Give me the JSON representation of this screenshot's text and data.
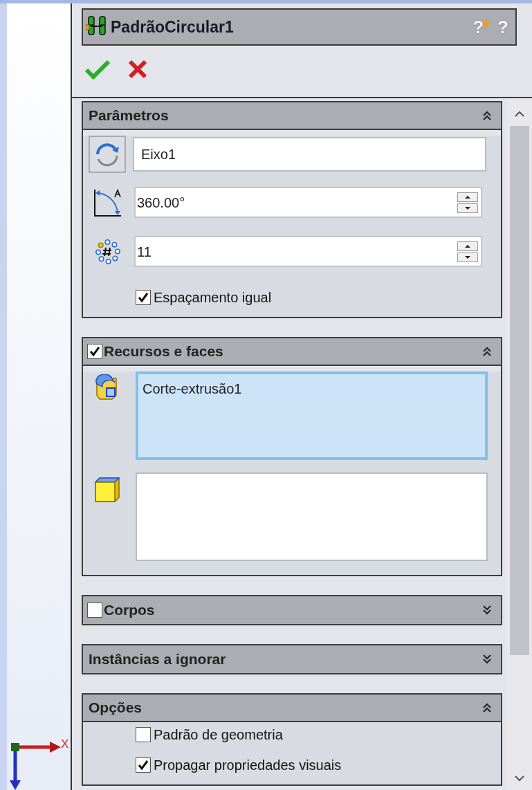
{
  "title_bar": {
    "title": "PadrãoCircular1",
    "help_buttons": [
      "?",
      "?"
    ]
  },
  "groups": [
    {
      "title": "Parâmetros",
      "expanded": true,
      "rows": [
        {
          "kind": "axis",
          "value": "Eixo1"
        },
        {
          "kind": "angle",
          "value": "360.00°"
        },
        {
          "kind": "count",
          "value": "11"
        },
        {
          "kind": "check",
          "label": "Espaçamento igual",
          "checked": true
        }
      ]
    },
    {
      "title": "Recursos e faces",
      "expanded": true,
      "checkbox": {
        "checked": true
      },
      "rows": [
        {
          "kind": "features",
          "items": [
            "Corte-extrusão1"
          ],
          "focused": true
        },
        {
          "kind": "faces",
          "focused": false
        }
      ]
    },
    {
      "title": "Corpos",
      "expanded": false,
      "checkbox": {
        "checked": false
      }
    },
    {
      "title": "Instâncias a ignorar",
      "expanded": false
    },
    {
      "title": "Opções",
      "expanded": true,
      "rows": [
        {
          "kind": "check",
          "label": "Padrão de geometria",
          "checked": false
        },
        {
          "kind": "check",
          "label": "Propagar propriedades visuais",
          "checked": true
        }
      ]
    }
  ],
  "triad": {
    "x_label": "X"
  }
}
